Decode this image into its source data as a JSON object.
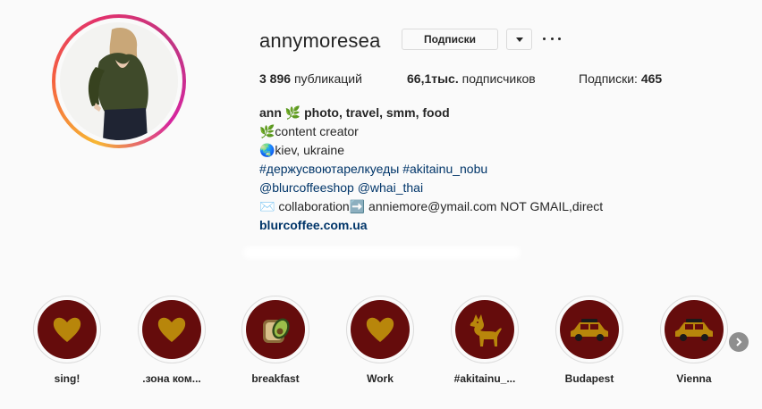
{
  "profile": {
    "username": "annymoresea",
    "follow_label": "Подписки",
    "posts_count": "3 896",
    "posts_label": "публикаций",
    "followers_count": "66,1тыс.",
    "followers_label": "подписчиков",
    "following_label": "Подписки:",
    "following_count": "465"
  },
  "bio": {
    "name": "ann 🌿 photo, travel, smm, food",
    "line1": "🌿content creator",
    "line2": "🌏kiev, ukraine",
    "hashtags": "#держусвоютарелкуеды #akitainu_nobu",
    "mentions": "@blurcoffeeshop @whai_thai",
    "contact": "✉️ collaboration➡️ anniemore@ymail.com NOT GMAIL,direct",
    "website": "blurcoffee.com.ua"
  },
  "highlights": [
    {
      "label": "sing!",
      "icon": "heart-icon"
    },
    {
      "label": ".зона ком...",
      "icon": "heart-icon"
    },
    {
      "label": "breakfast",
      "icon": "avocado-toast-icon"
    },
    {
      "label": "Work",
      "icon": "heart-icon"
    },
    {
      "label": "#akitainu_...",
      "icon": "dog-icon"
    },
    {
      "label": "Budapest",
      "icon": "car-icon"
    },
    {
      "label": "Vienna",
      "icon": "car-icon"
    }
  ],
  "colors": {
    "highlight_bg": "#650c0c",
    "highlight_icon": "#b8860b",
    "link": "#003569"
  }
}
